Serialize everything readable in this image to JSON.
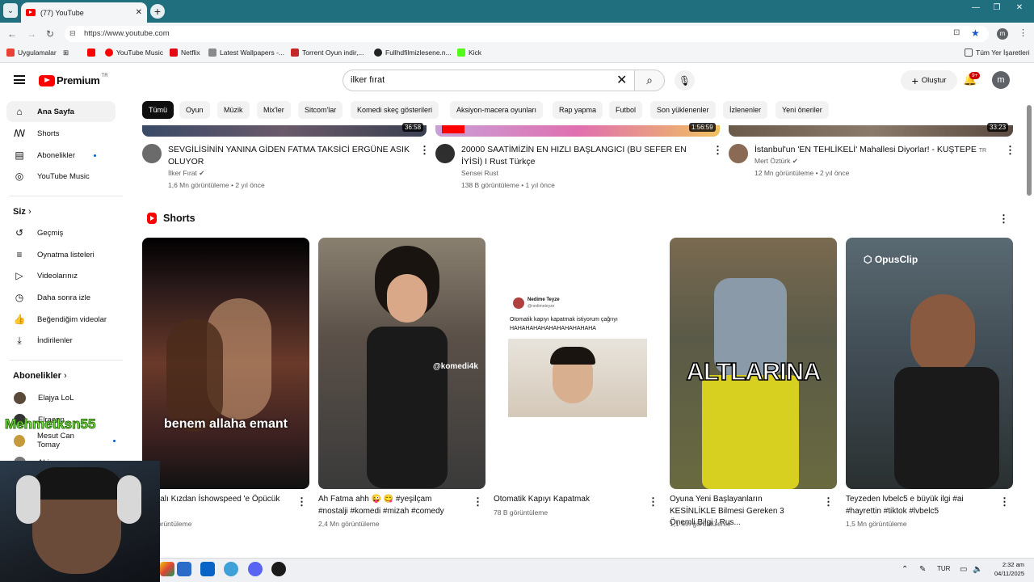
{
  "browser": {
    "tab_title": "(77) YouTube",
    "url": "https://www.youtube.com",
    "bookmarks": [
      {
        "label": "Uygulamalar",
        "color": "#e94235"
      },
      {
        "label": "YouTube Music",
        "color": "#ff0000"
      },
      {
        "label": "Netflix",
        "color": "#e50914"
      },
      {
        "label": "Latest Wallpapers -...",
        "color": "#8a8a8a"
      },
      {
        "label": "Torrent Oyun indir,...",
        "color": "#c62828"
      },
      {
        "label": "Fullhdfilmizlesene.n...",
        "color": "#222222"
      },
      {
        "label": "Kick",
        "color": "#53fc18"
      }
    ],
    "all_bookmarks": "Tüm Yer İşaretleri"
  },
  "header": {
    "logo_text": "Premium",
    "logo_sup": "TR",
    "search_value": "ilker fırat",
    "create_label": "Oluştur",
    "notif_badge": "9+",
    "avatar_letter": "m"
  },
  "sidebar": {
    "main": [
      {
        "label": "Ana Sayfa",
        "icon": "home-icon"
      },
      {
        "label": "Shorts",
        "icon": "shorts-icon"
      },
      {
        "label": "Abonelikler",
        "icon": "subscriptions-icon"
      },
      {
        "label": "YouTube Music",
        "icon": "music-icon"
      }
    ],
    "you_header": "Siz",
    "you": [
      {
        "label": "Geçmiş",
        "icon": "history-icon"
      },
      {
        "label": "Oynatma listeleri",
        "icon": "playlists-icon"
      },
      {
        "label": "Videolarınız",
        "icon": "your-videos-icon"
      },
      {
        "label": "Daha sonra izle",
        "icon": "watch-later-icon"
      },
      {
        "label": "Beğendiğim videolar",
        "icon": "liked-icon"
      },
      {
        "label": "İndirilenler",
        "icon": "downloads-icon"
      }
    ],
    "subs_header": "Abonelikler",
    "subs": [
      {
        "label": "Elajya LoL",
        "color": "#5a4a3a"
      },
      {
        "label": "Elraenn",
        "color": "#333333"
      },
      {
        "label": "Mesut Can Tomay",
        "color": "#c49a3c"
      },
      {
        "label": "Abiyon",
        "color": "#777777"
      }
    ]
  },
  "chips": [
    "Tümü",
    "Oyun",
    "Müzik",
    "Mix'ler",
    "Sitcom'lar",
    "Komedi skeç gösterileri",
    "Aksiyon-macera oyunları",
    "Rap yapma",
    "Futbol",
    "Son yüklenenler",
    "İzlenenler",
    "Yeni öneriler"
  ],
  "videos": [
    {
      "duration": "36:58",
      "title": "SEVGİLİSİNİN YANINA GİDEN FATMA TAKSİCİ ERGÜNE ASIK OLUYOR",
      "channel": "İlker Fırat",
      "views": "1,6 Mn görüntüleme",
      "age": "2 yıl önce",
      "avatar_color": "#6b6b6b"
    },
    {
      "duration": "1:56:59",
      "title": "20000  SAATİMİZİN EN HIZLI BAŞLANGICI (BU SEFER EN İYİSİ) I Rust Türkçe",
      "channel": "Sensei Rust",
      "views": "138 B görüntüleme",
      "age": "1 yıl önce",
      "avatar_color": "#2e2e2e"
    },
    {
      "duration": "33:23",
      "title": "İstanbul'un 'EN TEHLİKELİ' Mahallesi Diyorlar! - KUŞTEPE",
      "title_badge": "TR",
      "channel": "Mert Öztürk",
      "views": "12 Mn görüntüleme",
      "age": "2 yıl önce",
      "avatar_color": "#8a6a55"
    }
  ],
  "shorts": {
    "header": "Shorts",
    "items": [
      {
        "title": "Bayılalı Kızdan İshowspeed 'e Öpücük 💋",
        "views": "Mn görüntüleme",
        "overlay": "benem allaha emant",
        "bg": "#3a2a2a"
      },
      {
        "title": "Ah Fatma ahh 😜 😋 #yeşilçam #nostalji #komedi #mizah #comedy",
        "views": "2,4 Mn görüntüleme",
        "overlay": "@komedi4k",
        "bg": "#5a5048"
      },
      {
        "title": "Otomatik Kapıyı Kapatmak",
        "views": "78 B görüntüleme",
        "tweet_name": "Nedime Teyze",
        "tweet_handle": "@nedimeteyze",
        "tweet_text": "Otomatik kapıyı kapatmak istiyorum çağrıyı HAHAHAHAHAHAHAHAHAHAHA",
        "bg": "#ffffff"
      },
      {
        "title": "Oyuna Yeni Başlayanların KESİNLİKLE Bilmesi Gereken 3 Önemli Bilgi ! Rus...",
        "views": "1,1 Mn görüntüleme",
        "overlay": "ALTLARINA",
        "bg": "#6b6a50"
      },
      {
        "title": "Teyzeden lvbelc5 e büyük ilgi #ai #hayrettin #tiktok #lvbelc5",
        "views": "1,5 Mn görüntüleme",
        "overlay": "OpusClip",
        "bg": "#3f4a52"
      }
    ]
  },
  "overlay_stream": {
    "name": "Mehmetksn55"
  },
  "taskbar": {
    "lang": "TUR",
    "time": "2:32 am",
    "date": "04/11/2025"
  }
}
